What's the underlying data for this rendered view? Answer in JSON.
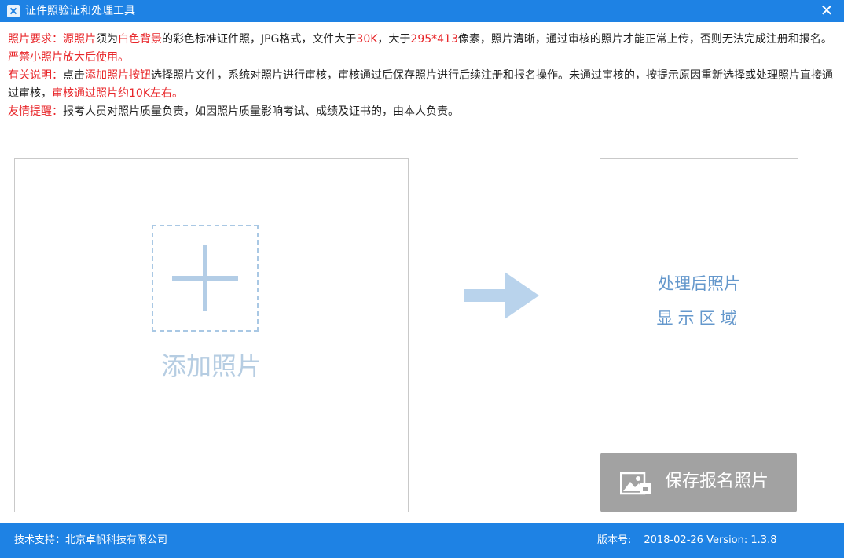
{
  "window": {
    "title": "证件照验证和处理工具",
    "close_glyph": "✕",
    "accent_color": "#1e82e4"
  },
  "notice": {
    "req_label": "照片要求：",
    "req_p1": "源照片",
    "req_p2": "须为",
    "req_p3": "白色背景",
    "req_p4": "的彩色标准证件照，JPG格式，文件大于",
    "req_p5": "30K",
    "req_p6": "，大于",
    "req_p7": "295*413",
    "req_p8": "像素，照片清晰，通过审核的照片才能正常上传，否则无法完成注册和报名。",
    "req_p9": "严禁小照片放大后使用。",
    "desc_label": "有关说明：",
    "desc_p1": "点击",
    "desc_p2": "添加照片按钮",
    "desc_p3": "选择照片文件，系统对照片进行审核，审核通过后保存照片进行后续注册和报名操作。未通过审核的，按提示原因重新选择或处理照片直接通过审核，",
    "desc_p4": "审核通过照片约10K左右。",
    "tip_label": "友情提醒：",
    "tip_p1": "报考人员对照片质量负责，如因照片质量影响考试、成绩及证书的，由本人负责。"
  },
  "upload": {
    "label": "添加照片",
    "icon": "plus-icon"
  },
  "preview": {
    "line1": "处理后照片",
    "line2": "显示区域"
  },
  "save": {
    "label": "保存报名照片",
    "icon": "image-icon"
  },
  "footer": {
    "support": "技术支持：北京卓帆科技有限公司",
    "version_label": "版本号:",
    "version_value": "2018-02-26 Version: 1.3.8"
  }
}
